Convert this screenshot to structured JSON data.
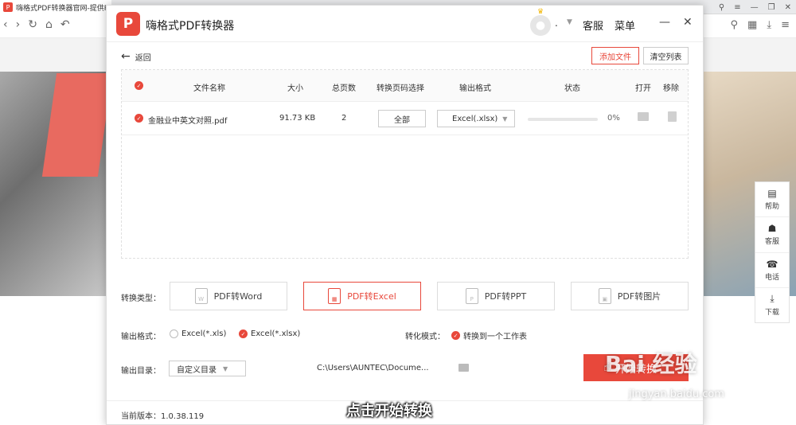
{
  "browser": {
    "tab_title": "嗨格式PDF转换器官网-提供P",
    "favicon": "P"
  },
  "sidebar": {
    "items": [
      {
        "label": "帮助",
        "icon": "book-icon"
      },
      {
        "label": "客服",
        "icon": "headset-icon"
      },
      {
        "label": "电话",
        "icon": "phone-icon"
      },
      {
        "label": "下载",
        "icon": "download-icon"
      }
    ]
  },
  "app": {
    "logo": "P",
    "title": "嗨格式PDF转换器",
    "user_name": ".",
    "service": "客服",
    "menu": "菜单",
    "back": "返回",
    "add_file": "添加文件",
    "clear_list": "清空列表"
  },
  "table": {
    "headers": [
      "文件名称",
      "大小",
      "总页数",
      "转换页码选择",
      "输出格式",
      "状态",
      "打开",
      "移除"
    ],
    "rows": [
      {
        "name": "金融业中英文对照.pdf",
        "size": "91.73 KB",
        "pages": "2",
        "page_select": "全部",
        "format": "Excel(.xlsx)",
        "progress": 0,
        "status": "0%"
      }
    ]
  },
  "convert": {
    "type_label": "转换类型：",
    "types": [
      "PDF转Word",
      "PDF转Excel",
      "PDF转PPT",
      "PDF转图片"
    ],
    "active_type": 1,
    "format_label": "输出格式：",
    "formats": [
      "Excel(*.xls)",
      "Excel(*.xlsx)"
    ],
    "selected_format": 1,
    "mode_label": "转化模式：",
    "mode_option": "转换到一个工作表",
    "dir_label": "输出目录：",
    "dir_select": "自定义目录",
    "dir_path": "C:\\Users\\AUNTEC\\Docume...",
    "start": "开始转换"
  },
  "version": "当前版本：1.0.38.119",
  "subtitle": "点击开始转换",
  "watermark": {
    "text": "Bai 经验",
    "url": "jingyan.baidu.com"
  },
  "colors": {
    "accent": "#e8483b"
  }
}
